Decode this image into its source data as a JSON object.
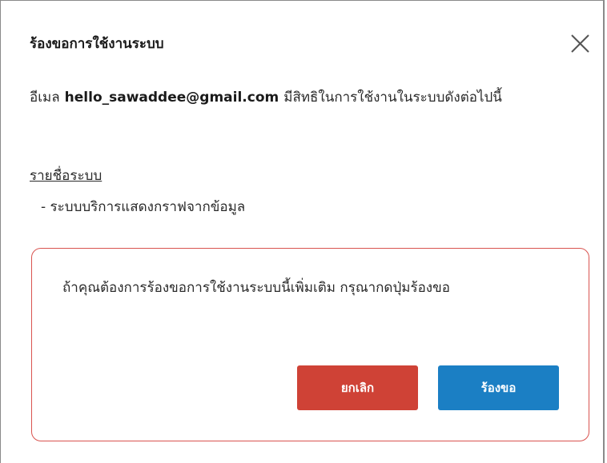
{
  "dialog": {
    "title": "ร้องขอการใช้งานระบบ",
    "close_icon": "close-icon"
  },
  "message": {
    "prefix": "อีเมล",
    "email": "hello_sawaddee@gmail.com",
    "suffix": "มีสิทธิในการใช้งานในระบบดังต่อไปนี้"
  },
  "systems": {
    "heading": "รายชื่อระบบ",
    "items": [
      "- ระบบบริการแสดงกราฟจากข้อมูล"
    ]
  },
  "notice": {
    "text": "ถ้าคุณต้องการร้องขอการใช้งานระบบนี้เพิ่มเติม กรุณากดปุ่มร้องขอ",
    "border_color": "#d9534f"
  },
  "buttons": {
    "cancel_label": "ยกเลิก",
    "cancel_color": "#cf4236",
    "request_label": "ร้องขอ",
    "request_color": "#1b7fc4"
  }
}
